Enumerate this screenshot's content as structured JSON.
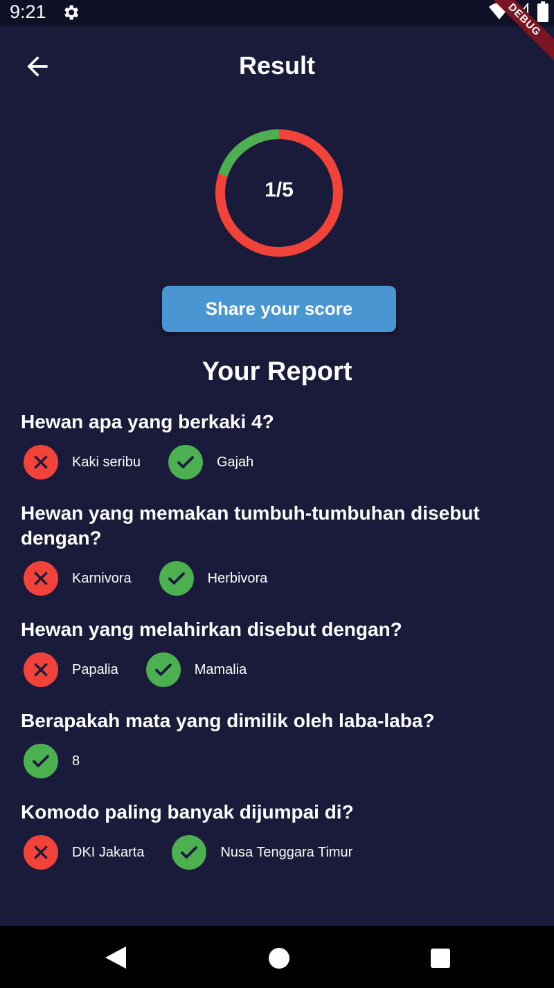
{
  "status_bar": {
    "time": "9:21",
    "debug_label": "DEBUG"
  },
  "app_bar": {
    "title": "Result",
    "back_icon": "arrow-left-icon"
  },
  "score": {
    "text": "1/5",
    "correct": 1,
    "total": 5,
    "correct_color": "#4caf50",
    "wrong_color": "#f1433a"
  },
  "share_button": {
    "label": "Share your score"
  },
  "report": {
    "title": "Your Report",
    "items": [
      {
        "question": "Hewan apa yang berkaki 4?",
        "answers": [
          {
            "label": "Kaki seribu",
            "status": "wrong",
            "icon": "x-icon"
          },
          {
            "label": "Gajah",
            "status": "right",
            "icon": "check-icon"
          }
        ]
      },
      {
        "question": "Hewan yang memakan tumbuh-tumbuhan disebut dengan?",
        "answers": [
          {
            "label": "Karnivora",
            "status": "wrong",
            "icon": "x-icon"
          },
          {
            "label": "Herbivora",
            "status": "right",
            "icon": "check-icon"
          }
        ]
      },
      {
        "question": "Hewan yang melahirkan disebut dengan?",
        "answers": [
          {
            "label": "Papalia",
            "status": "wrong",
            "icon": "x-icon"
          },
          {
            "label": "Mamalia",
            "status": "right",
            "icon": "check-icon"
          }
        ]
      },
      {
        "question": "Berapakah mata yang dimilik oleh laba-laba?",
        "answers": [
          {
            "label": "8",
            "status": "right",
            "icon": "check-icon"
          }
        ]
      },
      {
        "question": "Komodo paling banyak dijumpai di?",
        "answers": [
          {
            "label": "DKI Jakarta",
            "status": "wrong",
            "icon": "x-icon"
          },
          {
            "label": "Nusa Tenggara Timur",
            "status": "right",
            "icon": "check-icon"
          }
        ]
      }
    ]
  },
  "colors": {
    "background": "#1a1b3a",
    "status_bar": "#101127",
    "share_button": "#4a96d2",
    "nav_bar": "#000000"
  }
}
